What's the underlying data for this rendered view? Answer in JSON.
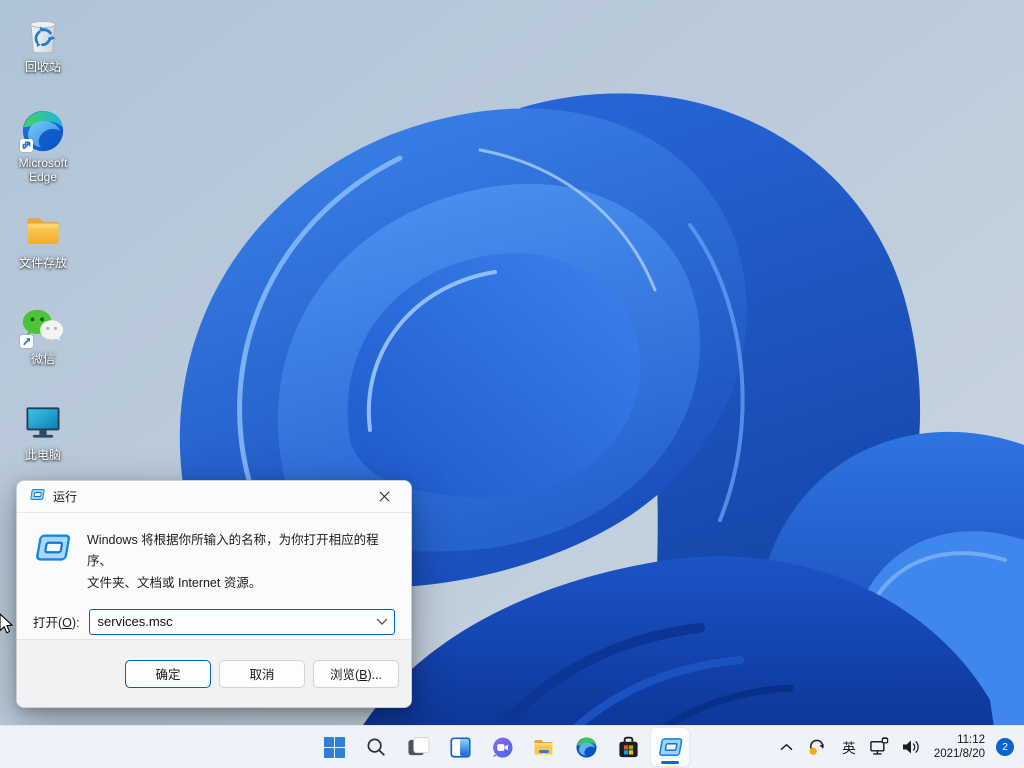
{
  "desktop": {
    "icons": [
      {
        "name": "recycle-bin",
        "label": "回收站"
      },
      {
        "name": "microsoft-edge",
        "label": "Microsoft Edge"
      },
      {
        "name": "file-folder",
        "label": "文件存放"
      },
      {
        "name": "wechat",
        "label": "微信"
      },
      {
        "name": "this-pc",
        "label": "此电脑"
      }
    ]
  },
  "run_dialog": {
    "title": "运行",
    "icon": "run-window-icon",
    "description_line1": "Windows 将根据你所输入的名称，为你打开相应的程序、",
    "description_line2": "文件夹、文档或 Internet 资源。",
    "open_label": {
      "pre": "打开(",
      "key": "O",
      "post": "):"
    },
    "input_value": "services.msc",
    "buttons": {
      "ok": "确定",
      "cancel": "取消",
      "browse": {
        "pre": "浏览(",
        "key": "B",
        "post": ")..."
      }
    }
  },
  "taskbar": {
    "apps": [
      {
        "name": "start",
        "icon": "windows-logo-icon"
      },
      {
        "name": "search",
        "icon": "search-icon"
      },
      {
        "name": "task-view",
        "icon": "task-view-icon"
      },
      {
        "name": "widgets",
        "icon": "widgets-icon"
      },
      {
        "name": "chat",
        "icon": "chat-icon"
      },
      {
        "name": "file-explorer",
        "icon": "folder-icon"
      },
      {
        "name": "edge",
        "icon": "edge-icon"
      },
      {
        "name": "store",
        "icon": "store-bag-icon"
      },
      {
        "name": "run",
        "icon": "run-window-icon",
        "active": true
      }
    ]
  },
  "tray": {
    "icons": [
      "chevron-up-icon",
      "sync-update-icon",
      "ime-indicator",
      "network-icon",
      "volume-icon"
    ],
    "ime": "英",
    "time": "11:12",
    "date": "2021/8/20",
    "badge_count": "2"
  },
  "colors": {
    "accent": "#0067c0",
    "taskbar_bg": "#eff3f9",
    "badge": "#0a63cf",
    "bloom_primary": "#2b6be4",
    "desktop_bg": "#b7c8d9"
  }
}
